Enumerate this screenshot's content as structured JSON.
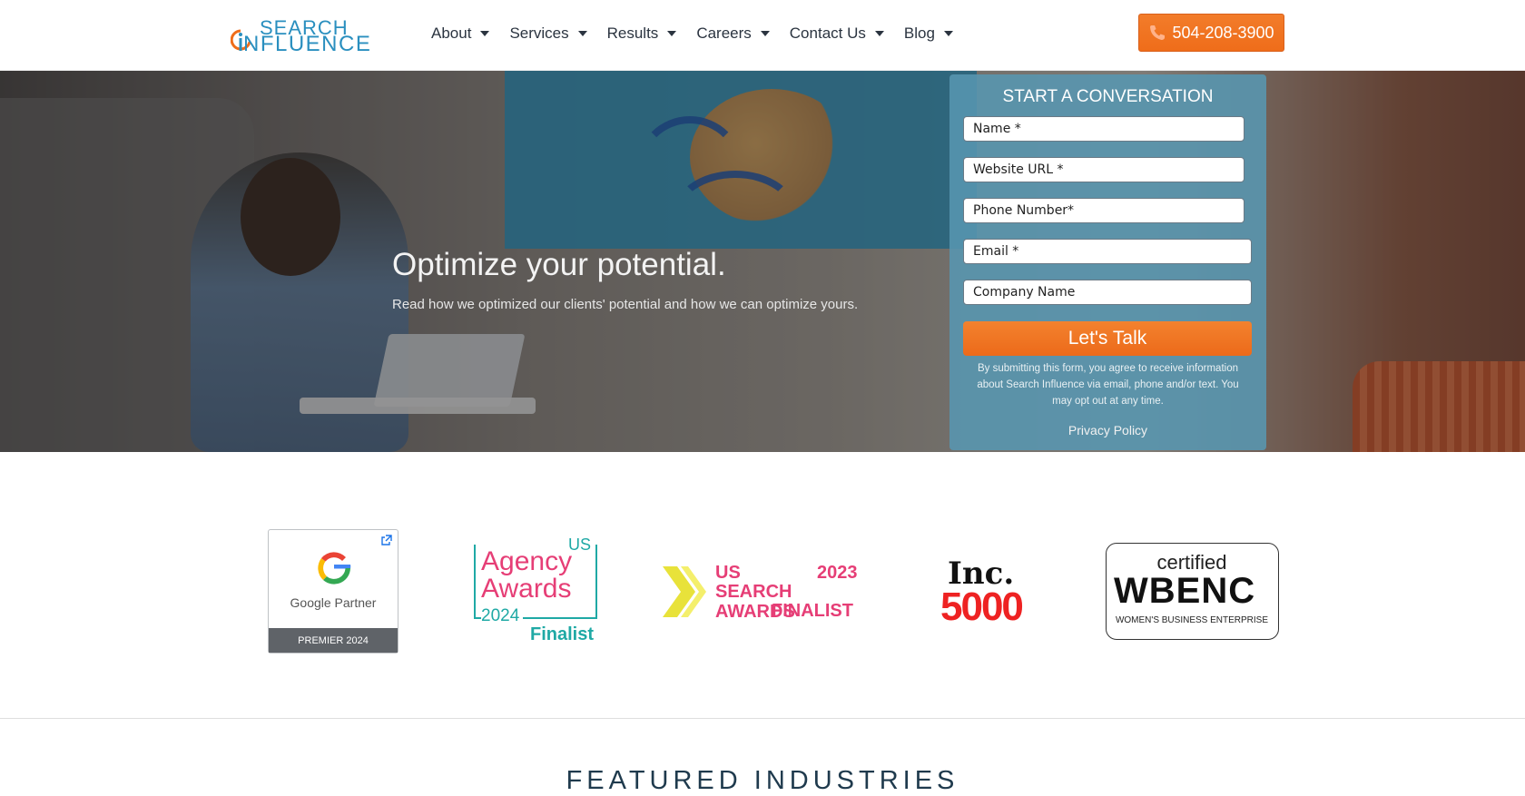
{
  "nav": {
    "logo_line1": "SEARCH",
    "logo_line2": "NFLUENCE",
    "items": [
      {
        "label": "About"
      },
      {
        "label": "Services"
      },
      {
        "label": "Results"
      },
      {
        "label": "Careers"
      },
      {
        "label": "Contact Us"
      },
      {
        "label": "Blog"
      }
    ],
    "phone": "504-208-3900",
    "phone_icon": "phone-icon",
    "accent": "#ef6d1a"
  },
  "hero": {
    "title": "Optimize your potential.",
    "subtitle": "Read how we optimized our clients' potential and how we can optimize yours."
  },
  "form": {
    "title": "START A CONVERSATION",
    "fields": {
      "name": "Name *",
      "website": "Website URL *",
      "phone": "Phone Number*",
      "email": "Email *",
      "company": "Company Name"
    },
    "submit": "Let's Talk",
    "disclaimer": "By submitting this form, you agree to receive information about Search Influence via email, phone and/or text. You may opt out at any time.",
    "privacy": "Privacy Policy",
    "panel_color": "#5896b0"
  },
  "awards": {
    "google": {
      "label": "Google Partner",
      "tier": "PREMIER 2024"
    },
    "agency": {
      "us": "US",
      "line1": "Agency",
      "line2": "Awards",
      "year": "2024",
      "status": "Finalist"
    },
    "ussearch": {
      "line1": "US",
      "year": "2023",
      "line2": "SEARCH AWARDS",
      "line3": "FINALIST"
    },
    "inc": {
      "line1": "Inc.",
      "line2": "5000"
    },
    "wbenc": {
      "line1": "certified",
      "line2": "WBENC",
      "line3": "WOMEN'S BUSINESS ENTERPRISE"
    }
  },
  "featured": {
    "heading": "FEATURED INDUSTRIES"
  }
}
